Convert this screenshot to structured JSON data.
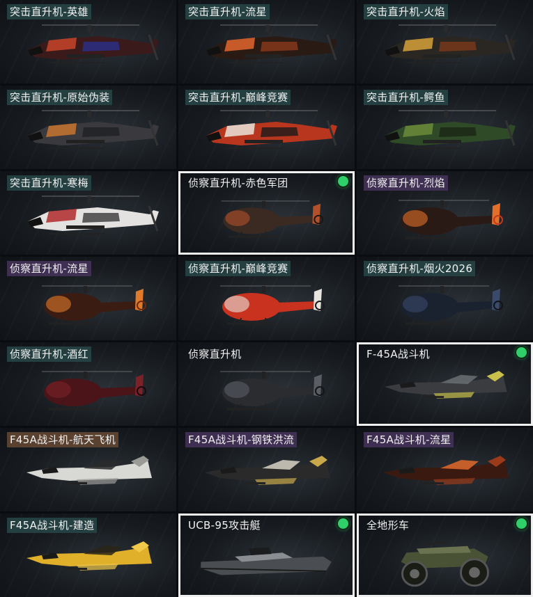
{
  "vehicles": [
    {
      "label": "突击直升机-英雄",
      "tag": "teal",
      "kind": "apache",
      "primary": "#3a1a1a",
      "accent": "#c9452a",
      "accent2": "#2a2f8a",
      "selected": false
    },
    {
      "label": "突击直升机-流星",
      "tag": "teal",
      "kind": "apache",
      "primary": "#2a1a14",
      "accent": "#e2662c",
      "accent2": "#8a3a1a",
      "selected": false
    },
    {
      "label": "突击直升机-火焰",
      "tag": "teal",
      "kind": "apache",
      "primary": "#2a2622",
      "accent": "#d6a23a",
      "accent2": "#7a3a1a",
      "selected": false
    },
    {
      "label": "突击直升机-原始伪装",
      "tag": "teal",
      "kind": "apache",
      "primary": "#3a3a3e",
      "accent": "#c8742e",
      "accent2": "#1e2024",
      "selected": false
    },
    {
      "label": "突击直升机-巅峰竞赛",
      "tag": "teal",
      "kind": "apache",
      "primary": "#b8361e",
      "accent": "#e9e4dc",
      "accent2": "#1a1a1a",
      "selected": false
    },
    {
      "label": "突击直升机-鳄鱼",
      "tag": "teal",
      "kind": "apache",
      "primary": "#2f4a26",
      "accent": "#6b8a3a",
      "accent2": "#1a2614",
      "selected": false
    },
    {
      "label": "突击直升机-寒梅",
      "tag": "teal",
      "kind": "apache",
      "primary": "#e4e2e0",
      "accent": "#b22a2a",
      "accent2": "#3a3a3a",
      "selected": false
    },
    {
      "label": "侦察直升机-赤色军团",
      "tag": "plain",
      "kind": "scout",
      "primary": "#3a2a22",
      "accent": "#b2502a",
      "accent2": "#1a1614",
      "selected": true
    },
    {
      "label": "侦察直升机-烈焰",
      "tag": "purple",
      "kind": "scout",
      "primary": "#2a1a16",
      "accent": "#e2702a",
      "accent2": "#c23a1a",
      "selected": false
    },
    {
      "label": "侦察直升机-流星",
      "tag": "purple",
      "kind": "scout",
      "primary": "#3a1c12",
      "accent": "#e07a2a",
      "accent2": "#6a2a10",
      "selected": false
    },
    {
      "label": "侦察直升机-巅峰竞赛",
      "tag": "teal",
      "kind": "scout",
      "primary": "#c8321e",
      "accent": "#e8e4de",
      "accent2": "#1a1a1a",
      "selected": false
    },
    {
      "label": "侦察直升机-烟火2026",
      "tag": "teal",
      "kind": "scout",
      "primary": "#1a2230",
      "accent": "#3a4a6a",
      "accent2": "#101418",
      "selected": false
    },
    {
      "label": "侦察直升机-酒红",
      "tag": "teal",
      "kind": "scout",
      "primary": "#4a1418",
      "accent": "#7a2228",
      "accent2": "#1a0a0c",
      "selected": false
    },
    {
      "label": "侦察直升机",
      "tag": "plain",
      "kind": "scout",
      "primary": "#2a2c30",
      "accent": "#5a5e64",
      "accent2": "#141518",
      "selected": false
    },
    {
      "label": "F-45A战斗机",
      "tag": "plain",
      "kind": "jet",
      "primary": "#3a3c40",
      "accent": "#6a6e72",
      "accent2": "#c8c04a",
      "selected": true
    },
    {
      "label": "F45A战斗机-航天飞机",
      "tag": "brown",
      "kind": "jet",
      "primary": "#d8d8d4",
      "accent": "#2a2a2a",
      "accent2": "#9a9a96",
      "selected": false
    },
    {
      "label": "F45A战斗机-钢铁洪流",
      "tag": "purple",
      "kind": "jet",
      "primary": "#2a2a2a",
      "accent": "#d8d2c4",
      "accent2": "#c8a84a",
      "selected": false
    },
    {
      "label": "F45A战斗机-流星",
      "tag": "purple",
      "kind": "jet",
      "primary": "#3a1a10",
      "accent": "#e0682a",
      "accent2": "#9a3a1a",
      "selected": false
    },
    {
      "label": "F45A战斗机-建造",
      "tag": "teal",
      "kind": "jet",
      "primary": "#e0b02a",
      "accent": "#2a2418",
      "accent2": "#f0c84a",
      "selected": false
    },
    {
      "label": "UCB-95攻击艇",
      "tag": "plain",
      "kind": "boat",
      "primary": "#4a4e52",
      "accent": "#8a8e92",
      "accent2": "#1a1c1e",
      "selected": true
    },
    {
      "label": "全地形车",
      "tag": "plain",
      "kind": "atv",
      "primary": "#4a5236",
      "accent": "#6a7250",
      "accent2": "#1a1c16",
      "selected": true
    }
  ]
}
